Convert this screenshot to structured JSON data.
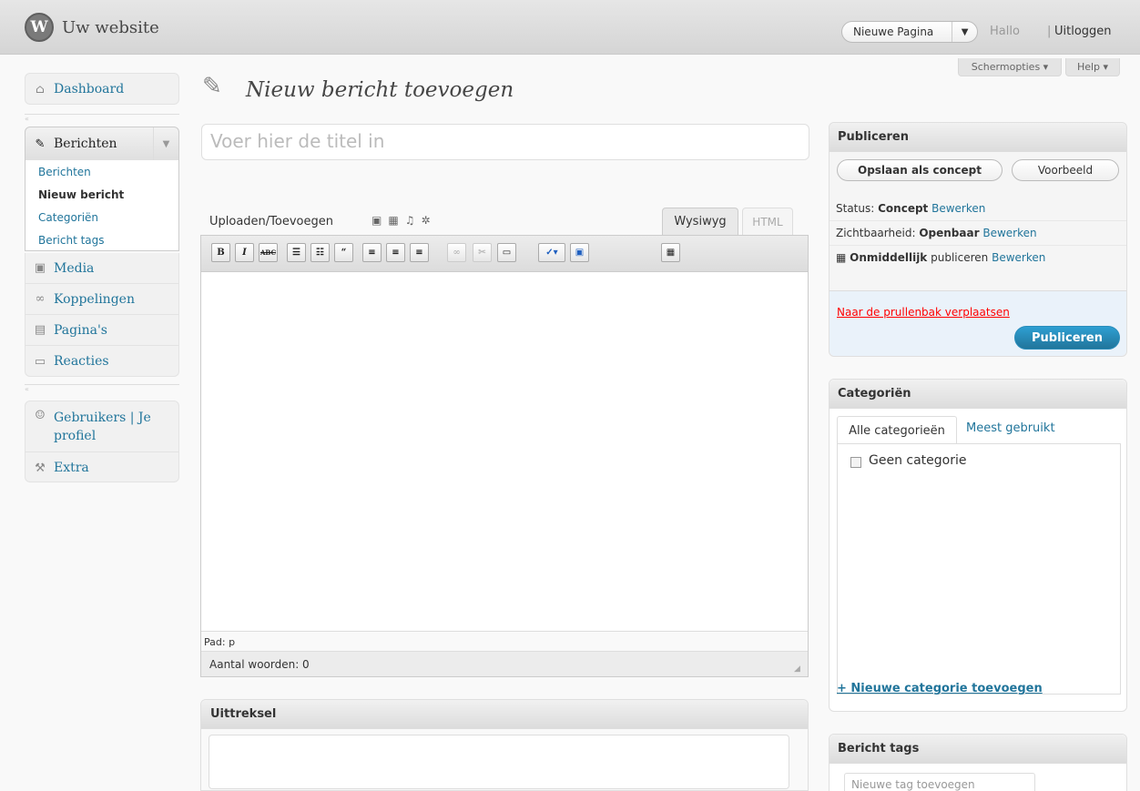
{
  "header": {
    "logo_text": "W",
    "site_title": "Uw website",
    "new_page_button": "Nieuwe Pagina",
    "new_page_dropdown": "▼",
    "greeting": "Hallo",
    "separator": "|",
    "logout": "Uitloggen",
    "screen_options": "Schermopties ▾",
    "help": "Help ▾"
  },
  "sidebar": {
    "dashboard": {
      "label": "Dashboard",
      "icon": "home-icon"
    },
    "berichten": {
      "label": "Berichten",
      "icon": "pushpin-icon"
    },
    "submenu": [
      "Berichten",
      "Nieuw bericht",
      "Categoriën",
      "Bericht tags"
    ],
    "items": [
      {
        "label": "Media",
        "icon": "media-icon"
      },
      {
        "label": "Koppelingen",
        "icon": "links-icon"
      },
      {
        "label": "Pagina's",
        "icon": "pages-icon"
      },
      {
        "label": "Reacties",
        "icon": "comments-icon"
      }
    ],
    "users": {
      "label": "Gebruikers | Je profiel",
      "icon": "users-icon"
    },
    "extra": {
      "label": "Extra",
      "icon": "tools-icon"
    }
  },
  "main": {
    "page_title": "Nieuw bericht toevoegen",
    "title_placeholder": "Voer hier de titel in",
    "upload_label": "Uploaden/Toevoegen",
    "tab_visual": "Wysiwyg",
    "tab_html": "HTML",
    "toolbar": {
      "bold": "B",
      "italic": "I",
      "strike": "ABC",
      "quote": "“"
    },
    "path": "Pad: p",
    "word_count": "Aantal woorden: 0",
    "excerpt_title": "Uittreksel"
  },
  "publish": {
    "title": "Publiceren",
    "save_draft": "Opslaan als concept",
    "preview": "Voorbeeld",
    "status_label": "Status:",
    "status_value": "Concept",
    "visibility_label": "Zichtbaarheid:",
    "visibility_value": "Openbaar",
    "schedule_value": "Onmiddellijk",
    "schedule_label": "publiceren",
    "edit_link": "Bewerken",
    "trash": "Naar de prullenbak verplaatsen",
    "publish_button": "Publiceren"
  },
  "categories": {
    "title": "Categoriën",
    "tab_all": "Alle categorieën",
    "tab_popular": "Meest gebruikt",
    "items": [
      "Geen categorie"
    ],
    "add_new": "+ Nieuwe categorie toevoegen"
  },
  "tags": {
    "title": "Bericht tags",
    "placeholder": "Nieuwe tag toevoegen"
  },
  "colors": {
    "link": "#21759b",
    "publish_button": "#21759b",
    "trash": "#ff0000",
    "publish_footer_bg": "#eaf2fa"
  }
}
